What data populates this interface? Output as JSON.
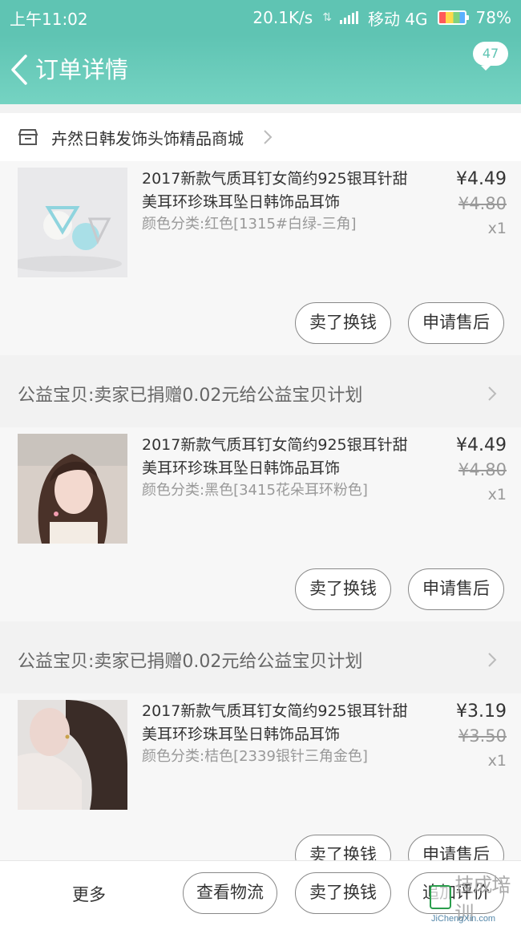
{
  "status_bar": {
    "time": "上午11:02",
    "net_speed": "20.1K/s",
    "carrier": "移动 4G",
    "battery": "78%"
  },
  "navbar": {
    "title": "订单详情",
    "badge_count": "47"
  },
  "shop": {
    "name": "卉然日韩发饰头饰精品商城"
  },
  "items": [
    {
      "title": "2017新款气质耳钉女简约925银耳针甜美耳环珍珠耳坠日韩饰品耳饰",
      "spec": "颜色分类:红色[1315#白绿-三角]",
      "price": "¥4.49",
      "original_price": "¥4.80",
      "quantity": "x1",
      "btn_sell": "卖了换钱",
      "btn_after_sale": "申请售后"
    },
    {
      "title": "2017新款气质耳钉女简约925银耳针甜美耳环珍珠耳坠日韩饰品耳饰",
      "spec": "颜色分类:黑色[3415花朵耳环粉色]",
      "price": "¥4.49",
      "original_price": "¥4.80",
      "quantity": "x1",
      "btn_sell": "卖了换钱",
      "btn_after_sale": "申请售后"
    },
    {
      "title": "2017新款气质耳钉女简约925银耳针甜美耳环珍珠耳坠日韩饰品耳饰",
      "spec": "颜色分类:桔色[2339银针三角金色]",
      "price": "¥3.19",
      "original_price": "¥3.50",
      "quantity": "x1",
      "btn_sell": "卖了换钱",
      "btn_after_sale": "申请售后"
    }
  ],
  "charity": {
    "text": "公益宝贝:卖家已捐赠0.02元给公益宝贝计划"
  },
  "bottom_bar": {
    "more": "更多",
    "logistics": "查看物流",
    "sell": "卖了换钱",
    "add_review": "追加评价"
  },
  "watermark": {
    "logo_text": "技成培训",
    "url": "JiChengXin.com"
  },
  "colors": {
    "accent": "#5fc4b3",
    "background": "#f2f2f2"
  }
}
